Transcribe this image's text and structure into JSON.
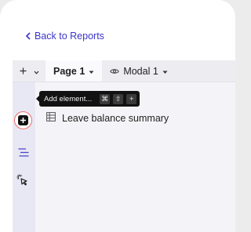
{
  "back_link": {
    "label": "Back to Reports"
  },
  "toolbar": {
    "add_page_icon": "plus-icon",
    "add_page_menu_icon": "chevron-down-icon",
    "tabs": [
      {
        "label": "Page 1",
        "active": true,
        "icon": ""
      },
      {
        "label": "Modal 1",
        "active": false,
        "icon": "eye-icon"
      }
    ]
  },
  "tooltip": {
    "text": "Add element...",
    "shortcut_keys": [
      "⌘",
      "⇧",
      "+"
    ]
  },
  "content": {
    "items": [
      {
        "label": "Leave balance summary",
        "icon": "table-icon"
      }
    ]
  },
  "colors": {
    "accent": "#3b35c9",
    "highlight_ring": "#f06b6b",
    "rail_bg": "#e8e8f4",
    "tooltip_bg": "#121212"
  }
}
